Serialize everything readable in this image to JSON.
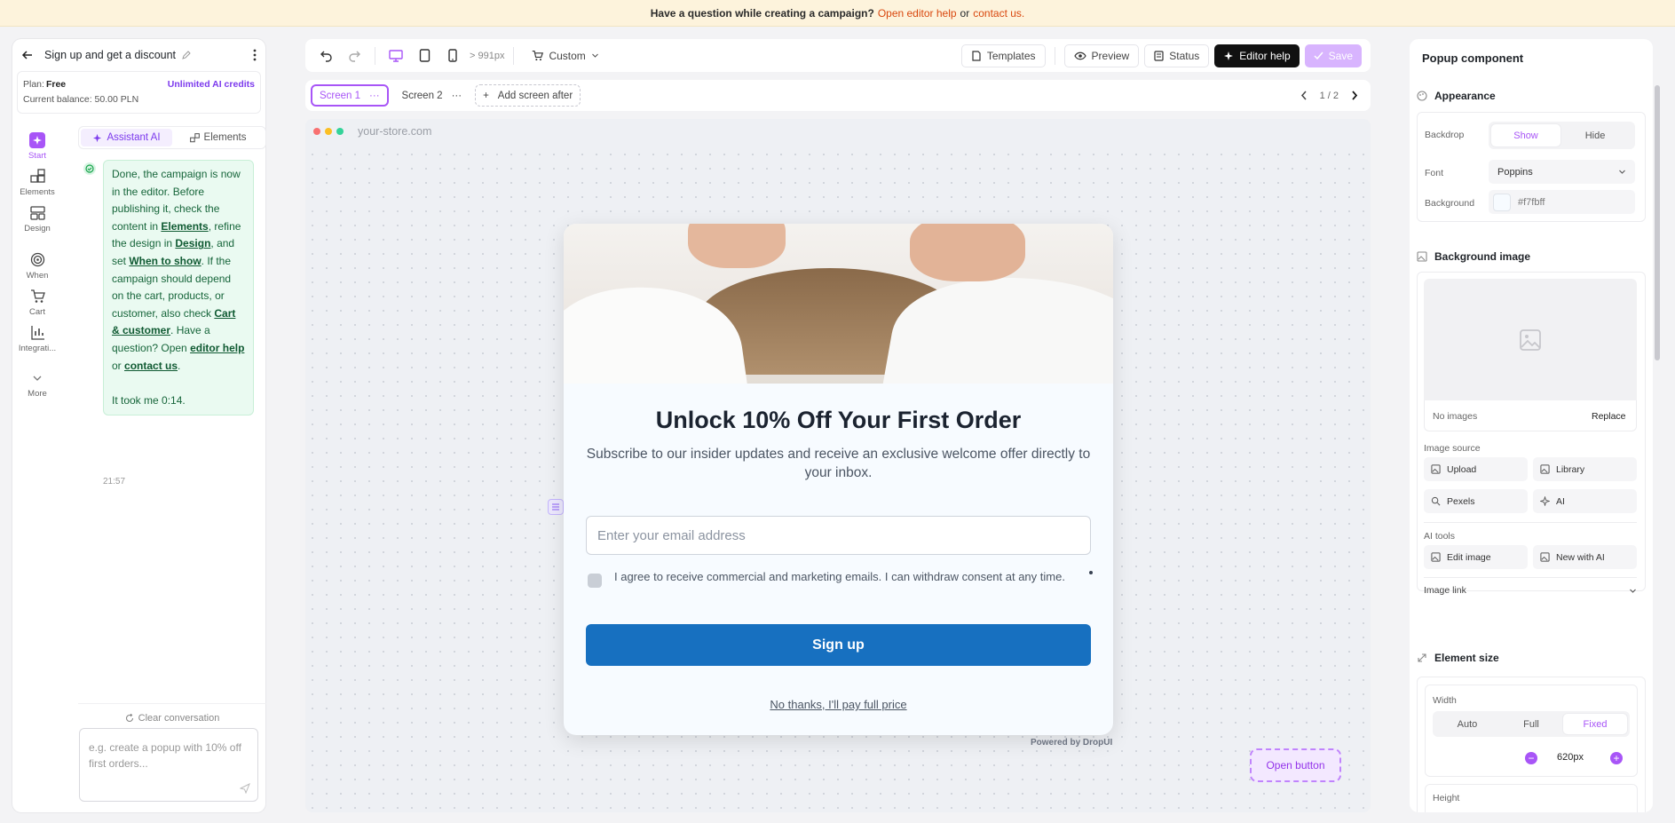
{
  "banner": {
    "question": "Have a question while creating a campaign?",
    "help_link": "Open editor help",
    "or": "or",
    "contact_link": "contact us."
  },
  "left": {
    "campaign_title": "Sign up and get a discount",
    "plan_label": "Plan:",
    "plan_value": "Free",
    "credits": "Unlimited AI credits",
    "balance": "Current balance: 50.00 PLN",
    "rail": [
      {
        "label": "Start"
      },
      {
        "label": "Elements"
      },
      {
        "label": "Design"
      },
      {
        "label": "When"
      },
      {
        "label": "Cart"
      },
      {
        "label": "Integrati..."
      },
      {
        "label": "More"
      }
    ],
    "tabs": {
      "assistant": "Assistant AI",
      "elements": "Elements"
    },
    "message": {
      "p1": "Done, the campaign is now in the editor. Before publishing it, check the content in ",
      "l1": "Elements",
      "p2": ", refine the design in ",
      "l2": "Design",
      "p3": ", and set ",
      "l3": "When to show",
      "p4": ". If the campaign should depend on the cart, products, or customer, also check ",
      "l4": "Cart & customer",
      "p5": ". Have a question? Open ",
      "l5": "editor help",
      "p6": " or ",
      "l6": "contact us",
      "p7": ".",
      "footer": "It took me 0:14.",
      "time": "21:57"
    },
    "clear": "Clear conversation",
    "input_placeholder": "e.g. create a popup with 10% off first orders..."
  },
  "toolbar": {
    "breakpoint": "> 991px",
    "custom": "Custom",
    "templates": "Templates",
    "preview": "Preview",
    "status": "Status",
    "editor_help": "Editor help",
    "save": "Save"
  },
  "screens": {
    "s1": "Screen 1",
    "s2": "Screen 2",
    "add": "Add screen after",
    "pager": "1 / 2"
  },
  "canvas": {
    "url": "your-store.com",
    "powered": "Powered by DropUI",
    "open_button": "Open button"
  },
  "popup": {
    "title": "Unlock 10% Off Your First Order",
    "subtitle": "Subscribe to our insider updates and receive an exclusive welcome offer directly to your inbox.",
    "email_placeholder": "Enter your email address",
    "consent": "I agree to receive commercial and marketing emails. I can withdraw consent at any time.",
    "signup": "Sign up",
    "decline": "No thanks, I'll pay full price"
  },
  "right": {
    "title": "Popup component",
    "appearance": "Appearance",
    "backdrop": "Backdrop",
    "show": "Show",
    "hide": "Hide",
    "font": "Font",
    "font_value": "Poppins",
    "background": "Background",
    "bg_value": "#f7fbff",
    "bg_image": "Background image",
    "no_images": "No images",
    "replace": "Replace",
    "image_source": "Image source",
    "upload": "Upload",
    "library": "Library",
    "pexels": "Pexels",
    "ai": "AI",
    "ai_tools": "AI tools",
    "edit_image": "Edit image",
    "new_with_ai": "New with AI",
    "image_link": "Image link",
    "element_size": "Element size",
    "width": "Width",
    "auto": "Auto",
    "full": "Full",
    "fixed": "Fixed",
    "width_value": "620px",
    "height": "Height"
  },
  "colors": {
    "accent": "#a855f7",
    "signup": "#1770c0",
    "popup_bg": "#f7fbff"
  }
}
